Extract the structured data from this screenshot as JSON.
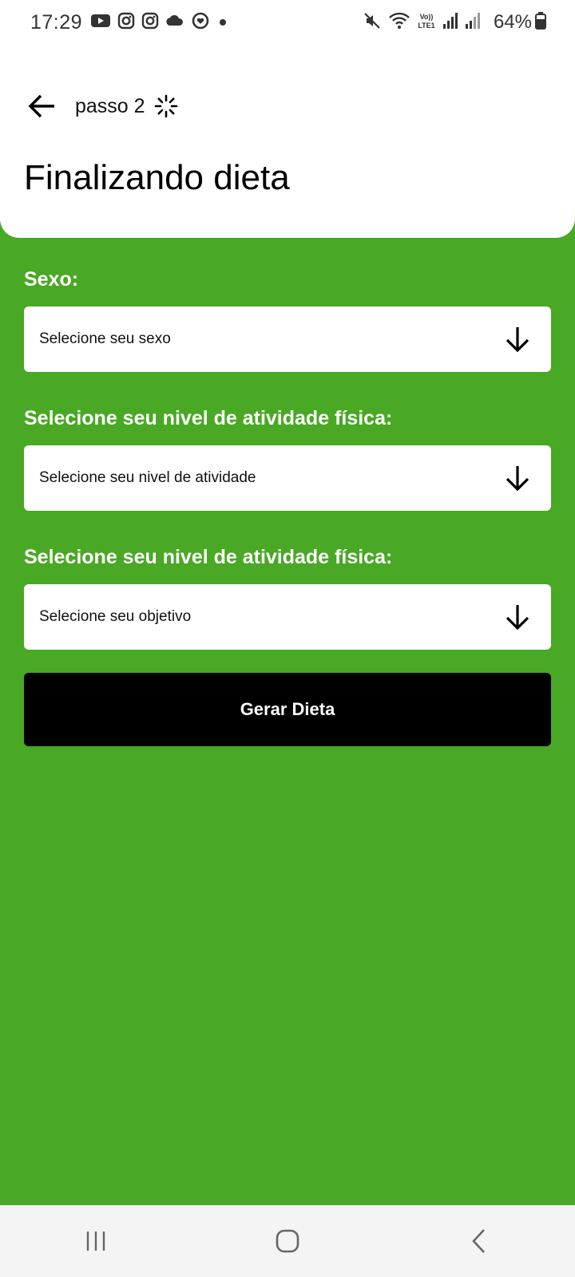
{
  "status_bar": {
    "time": "17:29",
    "battery": "64%",
    "icons": [
      "youtube-icon",
      "instagram-icon",
      "instagram-icon",
      "weather-icon",
      "app-icon",
      "dot-icon",
      "mute-icon",
      "wifi-icon",
      "volte-icon",
      "signal-icon",
      "signal-icon",
      "battery-icon"
    ]
  },
  "header": {
    "step": "passo 2",
    "title": "Finalizando dieta"
  },
  "form": {
    "sex": {
      "label": "Sexo:",
      "placeholder": "Selecione seu sexo"
    },
    "activity": {
      "label": "Selecione seu nivel de atividade física:",
      "placeholder": "Selecione seu nivel de atividade"
    },
    "goal": {
      "label": "Selecione seu nivel de atividade física:",
      "placeholder": "Selecione seu objetivo"
    },
    "submit_label": "Gerar Dieta"
  },
  "colors": {
    "background": "#49a824",
    "button": "#000000",
    "surface": "#ffffff"
  }
}
